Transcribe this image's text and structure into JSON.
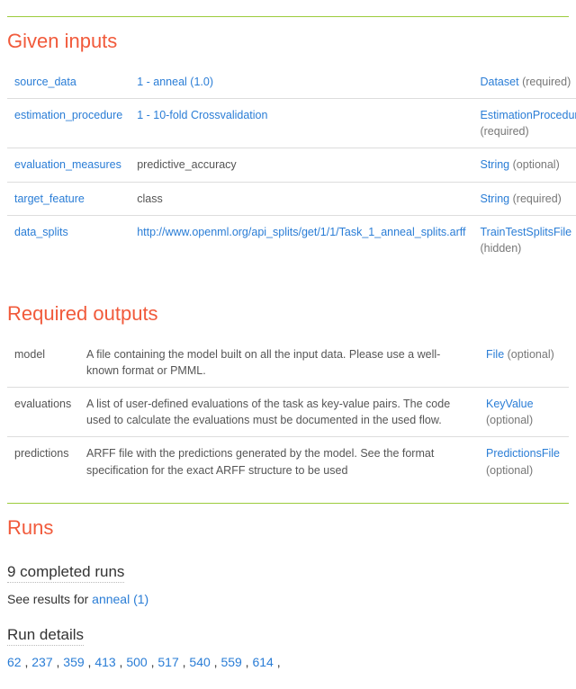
{
  "sections": {
    "inputs_title": "Given inputs",
    "outputs_title": "Required outputs",
    "runs_title": "Runs"
  },
  "inputs": [
    {
      "name": "source_data",
      "value": "1 - anneal (1.0)",
      "value_is_link": true,
      "type": "Dataset",
      "flag": "(required)"
    },
    {
      "name": "estimation_procedure",
      "value": "1 - 10-fold Crossvalidation",
      "value_is_link": true,
      "type": "EstimationProcedure",
      "flag": "(required)"
    },
    {
      "name": "evaluation_measures",
      "value": "predictive_accuracy",
      "value_is_link": false,
      "type": "String",
      "flag": "(optional)"
    },
    {
      "name": "target_feature",
      "value": "class",
      "value_is_link": false,
      "type": "String",
      "flag": "(required)"
    },
    {
      "name": "data_splits",
      "value": "http://www.openml.org/api_splits/get/1/1/Task_1_anneal_splits.arff",
      "value_is_link": true,
      "type": "TrainTestSplitsFile",
      "flag": "(hidden)"
    }
  ],
  "outputs": [
    {
      "name": "model",
      "desc": "A file containing the model built on all the input data. Please use a well-known format or PMML.",
      "type": "File",
      "flag": "(optional)"
    },
    {
      "name": "evaluations",
      "desc": "A list of user-defined evaluations of the task as key-value pairs. The code used to calculate the evaluations must be documented in the used flow.",
      "type": "KeyValue",
      "flag": "(optional)"
    },
    {
      "name": "predictions",
      "desc": "ARFF file with the predictions generated by the model. See the format specification for the exact ARFF structure to be used",
      "type": "PredictionsFile",
      "flag": "(optional)"
    }
  ],
  "runs": {
    "completed_label": "9 completed runs",
    "see_results_prefix": "See results for ",
    "see_results_link": "anneal (1)",
    "details_label": "Run details",
    "ids": [
      "62",
      "237",
      "359",
      "413",
      "500",
      "517",
      "540",
      "559",
      "614"
    ]
  }
}
